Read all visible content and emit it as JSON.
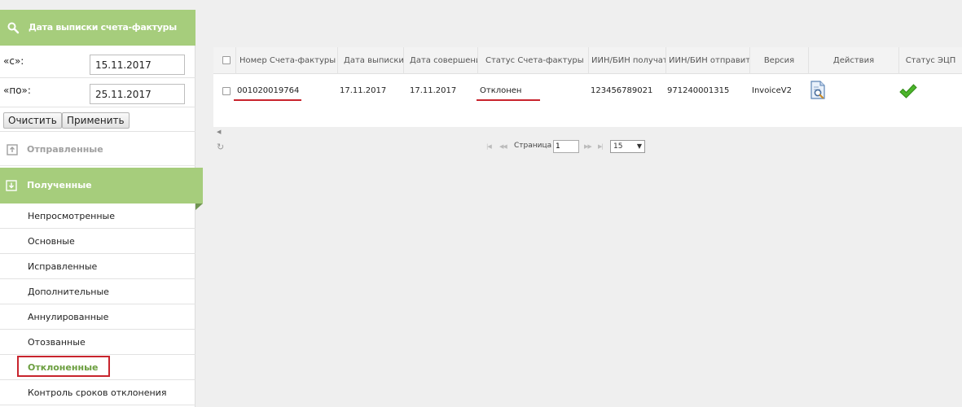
{
  "sidebar": {
    "date_filter": {
      "title": "Дата выписки счета-фактуры",
      "from_label": "«с»:",
      "from_value": "15.11.2017",
      "to_label": "«по»:",
      "to_value": "25.11.2017",
      "clear_label": "Очистить",
      "apply_label": "Применить"
    },
    "sent_label": "Отправленные",
    "received_label": "Полученные",
    "received_items": [
      {
        "label": "Непросмотренные"
      },
      {
        "label": "Основные"
      },
      {
        "label": "Исправленные"
      },
      {
        "label": "Дополнительные"
      },
      {
        "label": "Аннулированные"
      },
      {
        "label": "Отозванные"
      },
      {
        "label": "Отклоненные"
      },
      {
        "label": "Контроль сроков отклонения"
      }
    ],
    "active_item": "Отклоненные"
  },
  "grid": {
    "columns": [
      "Номер Счета-фактуры",
      "Дата выписки",
      "Дата совершения",
      "Статус Счета-фактуры",
      "ИИН/БИН получателя",
      "ИИН/БИН отправителя",
      "Версия",
      "Действия",
      "Статус ЭЦП"
    ],
    "rows": [
      {
        "number": "001020019764",
        "issue_date": "17.11.2017",
        "complete_date": "17.11.2017",
        "status": "Отклонен",
        "recipient_iin": "123456789021",
        "sender_iin": "971240001315",
        "version": "InvoiceV2",
        "action_icon": "view-document-icon",
        "signature_icon": "checkmark-icon"
      }
    ]
  },
  "pager": {
    "page_label": "Страница",
    "page_value": "1",
    "page_size": "15"
  },
  "colors": {
    "accent_green": "#a6cd7c",
    "active_text": "#6b9e3f",
    "highlight_red": "#c8242d"
  }
}
